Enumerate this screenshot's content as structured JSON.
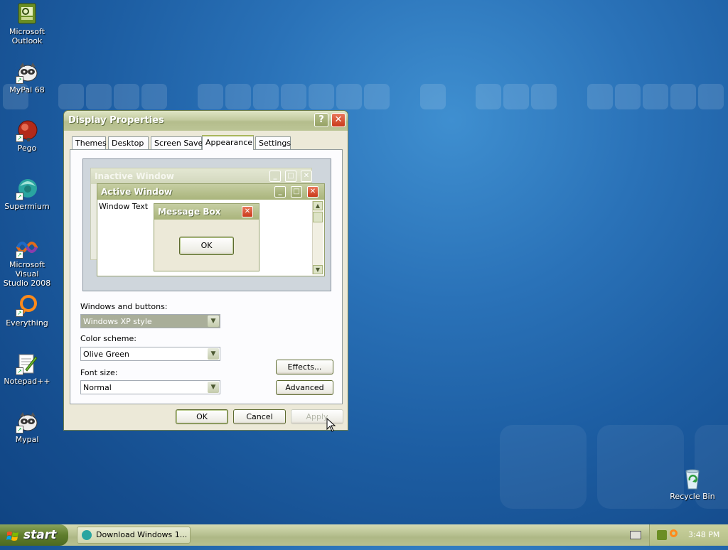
{
  "desktop": {
    "icons": [
      {
        "name": "Microsoft Outlook",
        "line1": "Microsoft",
        "line2": "Outlook"
      },
      {
        "name": "MyPal 68",
        "line1": "MyPal 68",
        "line2": ""
      },
      {
        "name": "Pego",
        "line1": "Pego",
        "line2": ""
      },
      {
        "name": "Supermium",
        "line1": "Supermium",
        "line2": ""
      },
      {
        "name": "Microsoft Visual Studio 2008",
        "line1": "Microsoft Visual",
        "line2": "Studio 2008"
      },
      {
        "name": "Everything",
        "line1": "Everything",
        "line2": ""
      },
      {
        "name": "Notepad++",
        "line1": "Notepad++",
        "line2": ""
      },
      {
        "name": "Mypal",
        "line1": "Mypal",
        "line2": ""
      }
    ],
    "recycle_bin": "Recycle Bin"
  },
  "dialog": {
    "title": "Display Properties",
    "help_glyph": "?",
    "close_glyph": "✕",
    "tabs": [
      "Themes",
      "Desktop",
      "Screen Saver",
      "Appearance",
      "Settings"
    ],
    "active_tab": "Appearance",
    "preview": {
      "inactive_title": "Inactive Window",
      "active_title": "Active Window",
      "window_text": "Window Text",
      "message_title": "Message Box",
      "ok": "OK"
    },
    "windows_buttons_label": "Windows and buttons:",
    "windows_buttons_value": "Windows XP style",
    "color_scheme_label": "Color scheme:",
    "color_scheme_value": "Olive Green",
    "font_size_label": "Font size:",
    "font_size_value": "Normal",
    "effects_button": "Effects...",
    "advanced_button": "Advanced",
    "ok_button": "OK",
    "cancel_button": "Cancel",
    "apply_button": "Apply"
  },
  "taskbar": {
    "start_label": "start",
    "task_item": "Download Windows 1...",
    "clock": "3:48 PM"
  },
  "colors": {
    "titlebar": "#b4bd8c",
    "desktop": "#2a72b8",
    "close_red": "#c9391a",
    "start_green": "#5f7d2c"
  }
}
